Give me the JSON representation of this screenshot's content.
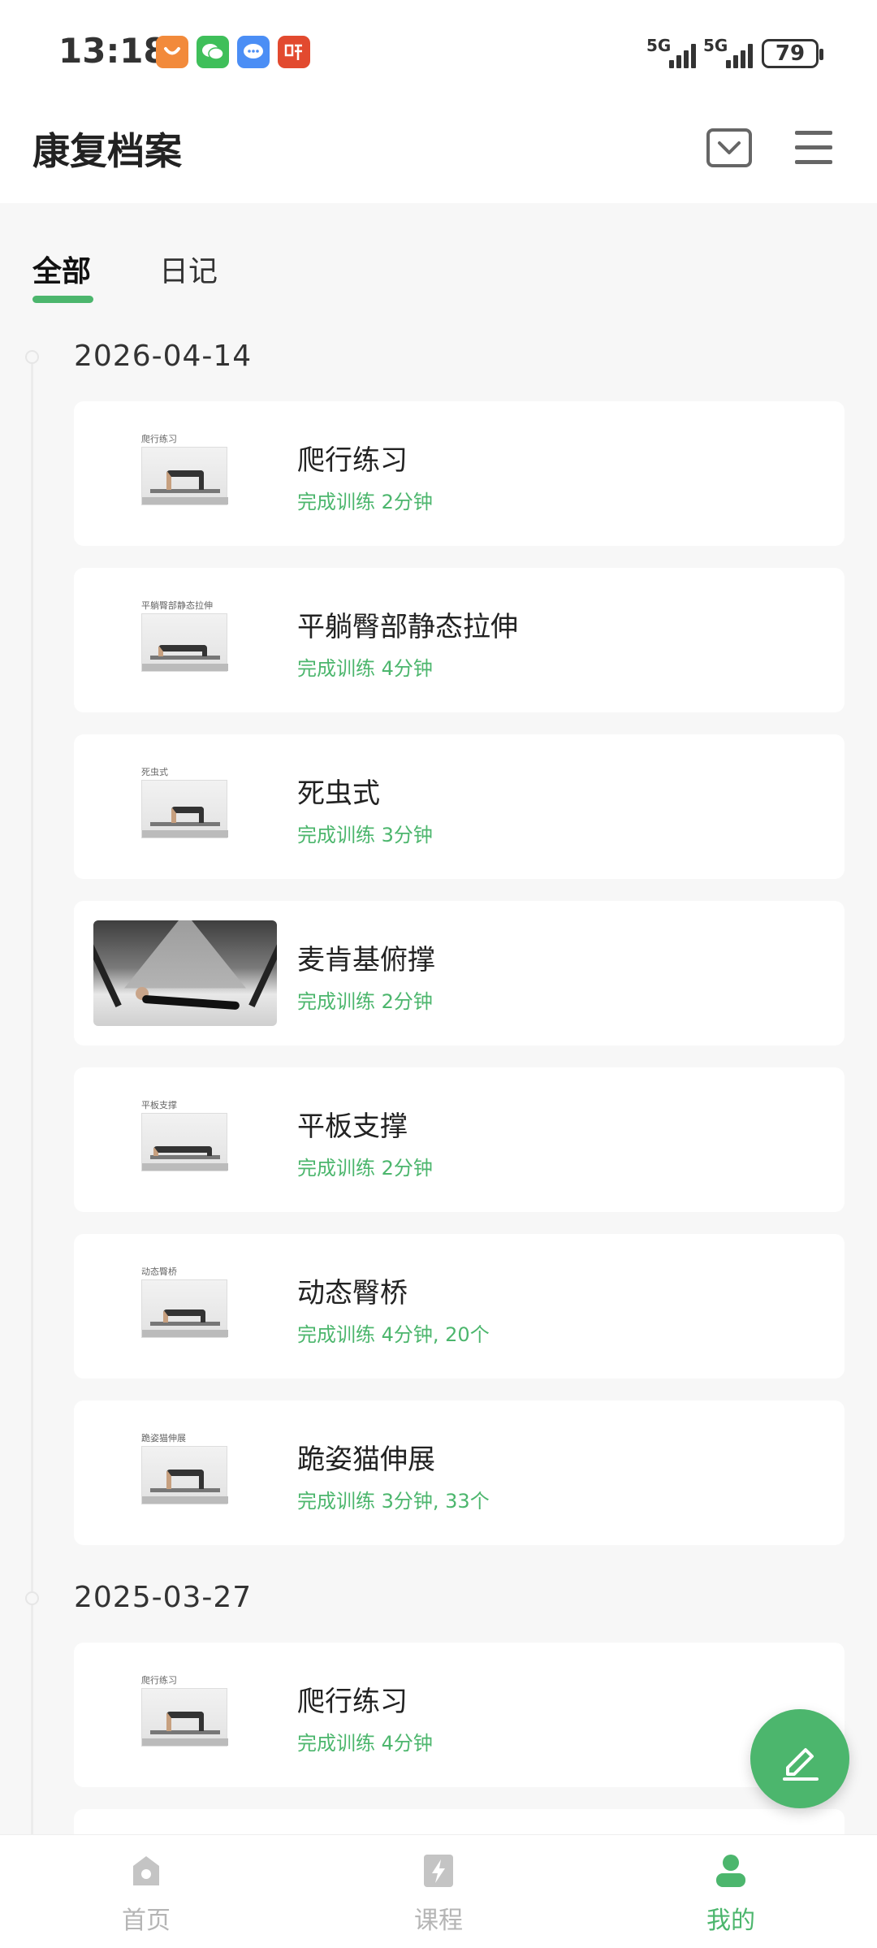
{
  "status_bar": {
    "time": "13:18",
    "signal1_label": "5G",
    "signal2_label": "5G",
    "battery": "79",
    "app_icons": [
      {
        "name": "taobao-icon",
        "color": "#f28a3b",
        "glyph": "◡"
      },
      {
        "name": "wechat-icon",
        "color": "#3fbf5a",
        "glyph": "✉"
      },
      {
        "name": "messages-icon",
        "color": "#4b8ef5",
        "glyph": "…"
      },
      {
        "name": "listen-app-icon",
        "color": "#e24a2f",
        "glyph": "听"
      }
    ]
  },
  "header": {
    "title": "康复档案"
  },
  "tabs": [
    {
      "label": "全部",
      "active": true
    },
    {
      "label": "日记",
      "active": false
    }
  ],
  "groups": [
    {
      "date": "2026-04-14",
      "items": [
        {
          "title": "爬行练习",
          "subtitle": "完成训练 2分钟",
          "thumb_label": "爬行练习",
          "thumb": "small"
        },
        {
          "title": "平躺臀部静态拉伸",
          "subtitle": "完成训练 4分钟",
          "thumb_label": "平躺臀部静态拉伸",
          "thumb": "small"
        },
        {
          "title": "死虫式",
          "subtitle": "完成训练 3分钟",
          "thumb_label": "死虫式",
          "thumb": "small"
        },
        {
          "title": "麦肯基俯撑",
          "subtitle": "完成训练 2分钟",
          "thumb_label": "",
          "thumb": "wide"
        },
        {
          "title": "平板支撑",
          "subtitle": "完成训练 2分钟",
          "thumb_label": "平板支撑",
          "thumb": "small"
        },
        {
          "title": "动态臀桥",
          "subtitle": "完成训练 4分钟, 20个",
          "thumb_label": "动态臀桥",
          "thumb": "small"
        },
        {
          "title": "跪姿猫伸展",
          "subtitle": "完成训练 3分钟, 33个",
          "thumb_label": "跪姿猫伸展",
          "thumb": "small"
        }
      ]
    },
    {
      "date": "2025-03-27",
      "items": [
        {
          "title": "爬行练习",
          "subtitle": "完成训练 4分钟",
          "thumb_label": "爬行练习",
          "thumb": "small"
        }
      ]
    }
  ],
  "bottom_nav": [
    {
      "label": "首页",
      "icon": "home-icon",
      "active": false
    },
    {
      "label": "课程",
      "icon": "lightning-icon",
      "active": false
    },
    {
      "label": "我的",
      "icon": "profile-icon",
      "active": true
    }
  ],
  "colors": {
    "accent": "#4cb66d",
    "background": "#f7f7f7",
    "card": "#ffffff"
  }
}
